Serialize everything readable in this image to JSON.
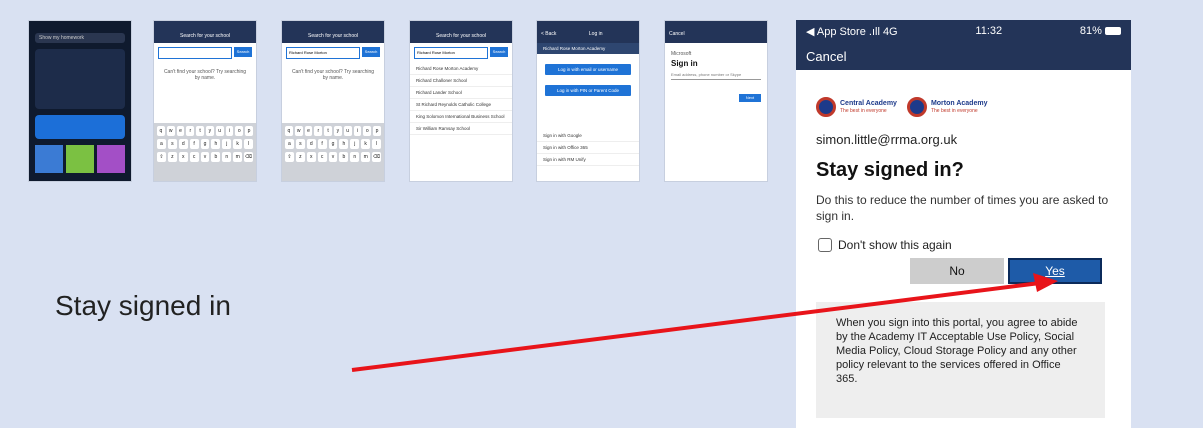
{
  "thumbs": {
    "t1": {
      "search": "Show my homework"
    },
    "t2": {
      "title": "Search for your school",
      "search_btn": "Search",
      "hint": "Can't find your school? Try searching by name."
    },
    "t3": {
      "title": "Search for your school",
      "query": "Richard Rose Morton",
      "search_btn": "Search"
    },
    "t4": {
      "title": "Search for your school",
      "query": "Richard Rose Morton",
      "search_btn": "Search",
      "results": [
        "Richard Rose Morton Academy",
        "Richard Challoner School",
        "Richard Lander School",
        "St Richard Reynolds Catholic College",
        "King Solomon International Business School",
        "Sir William Ramsay School"
      ]
    },
    "t5": {
      "back": "< Back",
      "title": "Log in",
      "school": "Richard Rose Morton Academy",
      "btn1": "Log in with email or username",
      "btn2": "Log in with PIN or Parent Code",
      "opt1": "Sign in with Google",
      "opt2": "Sign in with Office 365",
      "opt3": "Sign in with RM Unify"
    },
    "t6": {
      "cancel": "Cancel",
      "brand": "Microsoft",
      "title": "Sign in",
      "field": "Email address, phone number or Skype",
      "next": "Next"
    }
  },
  "phone": {
    "status": {
      "left": "◀ App Store .ıll 4G",
      "time": "11:32",
      "battery": "81%"
    },
    "cancel": "Cancel",
    "logo1": {
      "name": "Central Academy",
      "tag": "The best in everyone"
    },
    "logo2": {
      "name": "Morton Academy",
      "tag": "The best in everyone"
    },
    "email": "simon.little@rrma.org.uk",
    "heading": "Stay signed in?",
    "description": "Do this to reduce the number of times you are asked to sign in.",
    "checkbox_label": "Don't show this again",
    "no_label": "No",
    "yes_label": "Yes",
    "policy": "When you sign into this portal, you agree to abide by the Academy IT Acceptable Use Policy, Social Media Policy, Cloud Storage Policy and any other policy relevant to the services offered in Office 365."
  },
  "caption": "Stay signed in",
  "colors": {
    "navy": "#233458",
    "accent_blue": "#1e5ba8",
    "arrow": "#e8141a",
    "slide_bg": "#d9e1f2"
  }
}
